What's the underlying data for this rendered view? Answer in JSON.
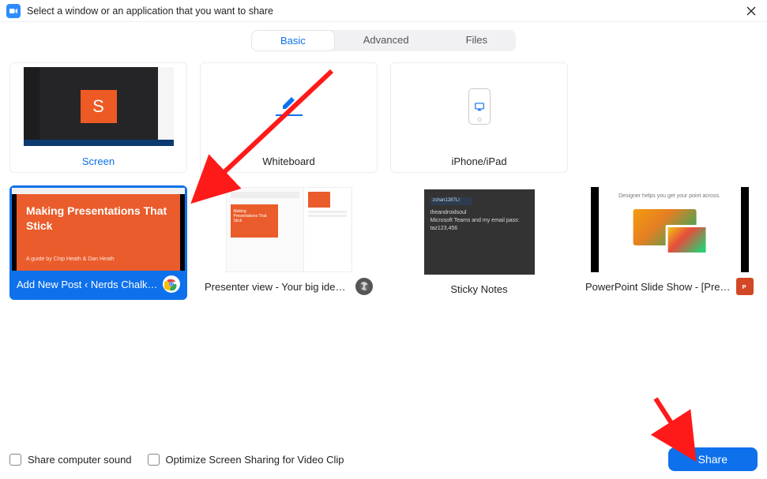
{
  "titlebar": {
    "title": "Select a window or an application that you want to share"
  },
  "tabs": {
    "basic": "Basic",
    "advanced": "Advanced",
    "files": "Files"
  },
  "cards": {
    "screen": {
      "label": "Screen"
    },
    "whiteboard": {
      "label": "Whiteboard"
    },
    "iphone": {
      "label": "iPhone/iPad"
    },
    "chrome": {
      "label": "Add New Post ‹ Nerds Chalk — …",
      "preview_title": "Making Presentations That Stick",
      "preview_sub": "A guide by Chip Heath & Dan Heath"
    },
    "presenter": {
      "label": "Presenter view - Your big idea - G…"
    },
    "sticky": {
      "label": "Sticky Notes",
      "note_lines": [
        "zshan1287LI",
        "theandroidsoul",
        "Microsoft Teams and my email pass:",
        "taz123,456"
      ]
    },
    "ppt": {
      "label": "PowerPoint Slide Show - [Present…",
      "preview_text": "Designer helps you get your point across."
    }
  },
  "footer": {
    "share_sound": "Share computer sound",
    "optimize": "Optimize Screen Sharing for Video Clip",
    "share": "Share"
  },
  "colors": {
    "accent": "#0e71eb",
    "orange": "#ea5c2b"
  }
}
